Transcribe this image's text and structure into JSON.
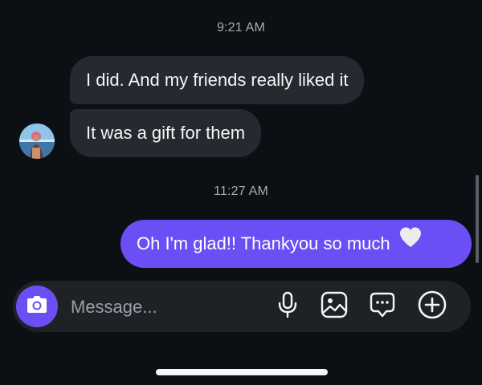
{
  "thread": {
    "timestamps": [
      "9:21 AM",
      "11:27 AM"
    ],
    "messages": [
      {
        "sender": "contact",
        "text": "I did. And my friends really liked it"
      },
      {
        "sender": "contact",
        "text": "It was a gift for them"
      },
      {
        "sender": "me",
        "text": "Oh I'm glad!! Thankyou so much",
        "emoji": "white-heart"
      }
    ]
  },
  "composer": {
    "placeholder": "Message...",
    "icons": [
      "camera-icon",
      "microphone-icon",
      "gallery-icon",
      "sticker-icon",
      "plus-circle-icon"
    ]
  },
  "colors": {
    "background": "#0c1014",
    "incoming_bubble": "#262a30",
    "outgoing_bubble": "#6b4ff5",
    "timestamp": "#a8acb3"
  }
}
